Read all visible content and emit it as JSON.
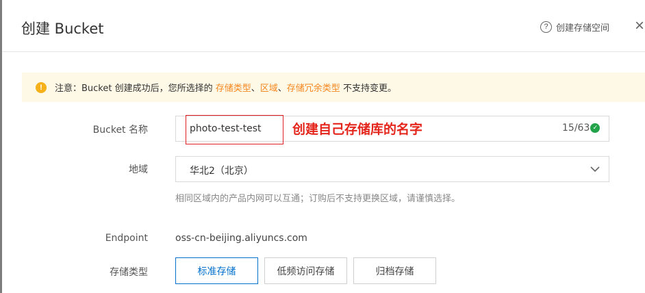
{
  "header": {
    "title": "创建 Bucket",
    "help_icon_glyph": "?",
    "help_label": "创建存储空间",
    "close_glyph": "×"
  },
  "notice": {
    "icon_glyph": "!",
    "prefix": "注意：Bucket 创建成功后，您所选择的 ",
    "highlight1": "存储类型",
    "sep1": "、",
    "highlight2": "区域",
    "sep2": "、",
    "highlight3": "存储冗余类型",
    "suffix": " 不支持变更。",
    "background": "#fef8e6",
    "highlight_color": "#f5871f"
  },
  "form": {
    "bucket_name": {
      "label": "Bucket 名称",
      "value": "photo-test-test",
      "counter": "15/63",
      "annotation": "创建自己存储库的名字",
      "annotation_color": "#e4251b"
    },
    "region": {
      "label": "地域",
      "value": "华北2（北京）",
      "hint": "相同区域内的产品内网可以互通；订购后不支持更换区域，请谨慎选择。"
    },
    "endpoint": {
      "label": "Endpoint",
      "value": "oss-cn-beijing.aliyuncs.com"
    },
    "storage_type": {
      "label": "存储类型",
      "options": [
        "标准存储",
        "低频访问存储",
        "归档存储"
      ],
      "selected": "标准存储",
      "accent": "#0070cc"
    }
  }
}
